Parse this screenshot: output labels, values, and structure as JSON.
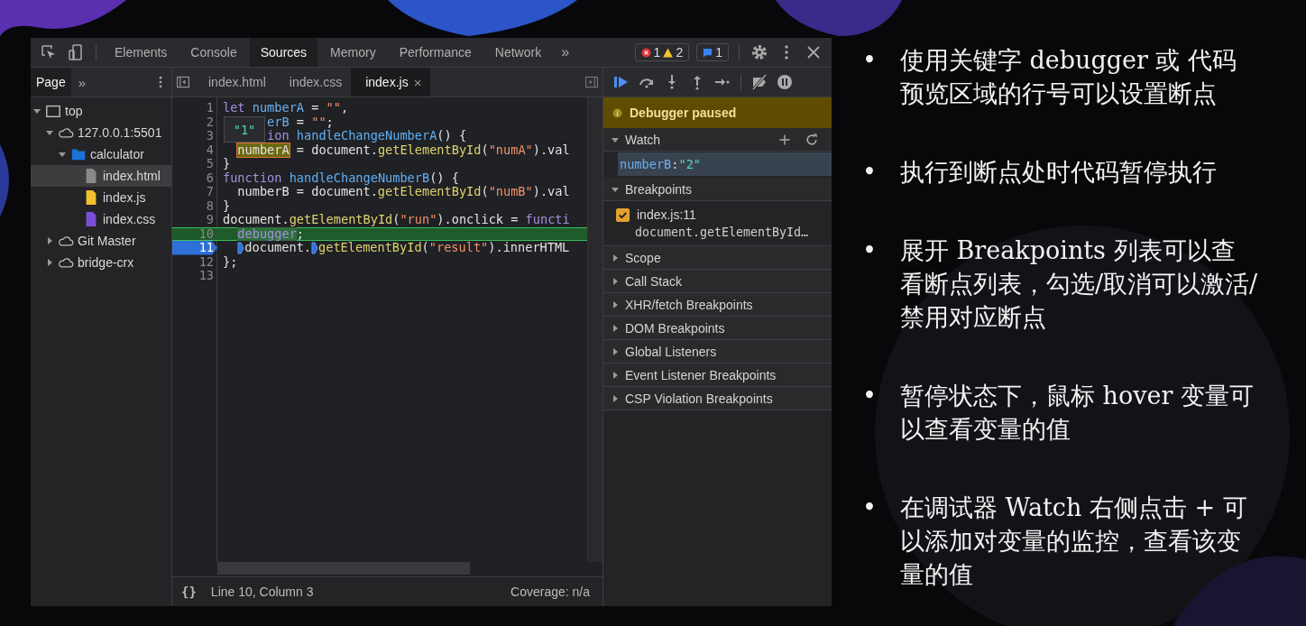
{
  "devtools": {
    "tabs": [
      {
        "label": "Elements",
        "selected": false
      },
      {
        "label": "Console",
        "selected": false
      },
      {
        "label": "Sources",
        "selected": true
      },
      {
        "label": "Memory",
        "selected": false
      },
      {
        "label": "Performance",
        "selected": false
      },
      {
        "label": "Network",
        "selected": false
      }
    ],
    "more_tabs": "»",
    "issues": {
      "errors": "1",
      "warnings": "2",
      "messages": "1"
    },
    "navigator": {
      "tabs": [
        {
          "label": "Page",
          "selected": true
        }
      ],
      "more": "»",
      "tree": [
        {
          "label": "top",
          "kind": "frame",
          "expanded": true,
          "selected": false,
          "children": [
            {
              "label": "127.0.0.1:5501",
              "kind": "cloud",
              "expanded": true,
              "selected": false,
              "children": [
                {
                  "label": "calculator",
                  "kind": "folder",
                  "expanded": true,
                  "selected": false,
                  "children": [
                    {
                      "label": "index.html",
                      "kind": "file",
                      "color": "#8a8a8a",
                      "selected": true
                    },
                    {
                      "label": "index.js",
                      "kind": "file",
                      "color": "#f0c02e",
                      "selected": false
                    },
                    {
                      "label": "index.css",
                      "kind": "file",
                      "color": "#7a4fd8",
                      "selected": false
                    }
                  ]
                }
              ]
            },
            {
              "label": "Git Master",
              "kind": "cloud",
              "expanded": false,
              "selected": false
            },
            {
              "label": "bridge-crx",
              "kind": "cloud",
              "expanded": false,
              "selected": false
            }
          ]
        }
      ]
    },
    "editor": {
      "tabs": [
        {
          "label": "index.html",
          "selected": false,
          "closable": false
        },
        {
          "label": "index.css",
          "selected": false,
          "closable": false
        },
        {
          "label": "index.js",
          "selected": true,
          "closable": true
        }
      ],
      "close_glyph": "×",
      "tooltip": "\"1\"",
      "lines": [
        {
          "number": "1",
          "tokens": [
            {
              "text": "let",
              "kind": "kw"
            },
            {
              "text": " numberA",
              "kind": "var"
            },
            {
              "text": " = ",
              "kind": "plain"
            },
            {
              "text": "\"\"",
              "kind": "str"
            },
            {
              "text": ",",
              "kind": "plain"
            }
          ]
        },
        {
          "number": "2",
          "covered": true,
          "tokens": [
            {
              "text": "erB",
              "kind": "var"
            },
            {
              "text": " = ",
              "kind": "plain"
            },
            {
              "text": "\"\"",
              "kind": "str"
            },
            {
              "text": ";",
              "kind": "plain"
            }
          ]
        },
        {
          "number": "3",
          "covered": true,
          "tokens": [
            {
              "text": "ion",
              "kind": "kw"
            },
            {
              "text": " handleChangeNumberA",
              "kind": "fn"
            },
            {
              "text": "() {",
              "kind": "plain"
            }
          ]
        },
        {
          "number": "4",
          "indent": true,
          "tokens": [
            {
              "text": "numberA",
              "kind": "hover"
            },
            {
              "text": " = document.",
              "kind": "plain"
            },
            {
              "text": "getElementById",
              "kind": "method"
            },
            {
              "text": "(",
              "kind": "plain"
            },
            {
              "text": "\"numA\"",
              "kind": "str"
            },
            {
              "text": ").val",
              "kind": "plain"
            }
          ]
        },
        {
          "number": "5",
          "tokens": [
            {
              "text": "}",
              "kind": "plain"
            }
          ]
        },
        {
          "number": "6",
          "tokens": [
            {
              "text": "function",
              "kind": "kw"
            },
            {
              "text": " handleChangeNumberB",
              "kind": "fn"
            },
            {
              "text": "() {",
              "kind": "plain"
            }
          ]
        },
        {
          "number": "7",
          "indent": true,
          "tokens": [
            {
              "text": "numberB = document.",
              "kind": "plain"
            },
            {
              "text": "getElementById",
              "kind": "method"
            },
            {
              "text": "(",
              "kind": "plain"
            },
            {
              "text": "\"numB\"",
              "kind": "str"
            },
            {
              "text": ").val",
              "kind": "plain"
            }
          ]
        },
        {
          "number": "8",
          "tokens": [
            {
              "text": "}",
              "kind": "plain"
            }
          ]
        },
        {
          "number": "9",
          "tokens": [
            {
              "text": "document.",
              "kind": "plain"
            },
            {
              "text": "getElementById",
              "kind": "method"
            },
            {
              "text": "(",
              "kind": "plain"
            },
            {
              "text": "\"run\"",
              "kind": "str"
            },
            {
              "text": ").onclick = ",
              "kind": "plain"
            },
            {
              "text": "functi",
              "kind": "kw"
            }
          ]
        },
        {
          "number": "10",
          "paused": true,
          "indent": true,
          "tokens": [
            {
              "text": "debugger",
              "kind": "current"
            },
            {
              "text": ";",
              "kind": "plain"
            }
          ]
        },
        {
          "number": "11",
          "breakpoint": true,
          "indent": true,
          "tokens": [
            {
              "kind": "marker"
            },
            {
              "text": "document.",
              "kind": "plain"
            },
            {
              "kind": "marker"
            },
            {
              "text": "getElementById",
              "kind": "method"
            },
            {
              "text": "(",
              "kind": "plain"
            },
            {
              "text": "\"result\"",
              "kind": "str"
            },
            {
              "text": ").innerHTML",
              "kind": "plain"
            }
          ]
        },
        {
          "number": "12",
          "tokens": [
            {
              "text": "};",
              "kind": "plain"
            }
          ]
        },
        {
          "number": "13"
        }
      ],
      "status": {
        "format": "{}",
        "position": "Line 10, Column 3",
        "coverage": "Coverage: n/a"
      }
    },
    "debugger": {
      "banner": "Debugger paused",
      "watch": {
        "title": "Watch",
        "expanded": true,
        "name": "numberB",
        "separator": ":",
        "value": "\"2\""
      },
      "breakpoints": {
        "title": "Breakpoints",
        "expanded": true,
        "items": [
          {
            "location": "index.js:11",
            "code": "document.getElementById…",
            "checked": true
          }
        ]
      },
      "sections": [
        {
          "title": "Scope",
          "expanded": false
        },
        {
          "title": "Call Stack",
          "expanded": false
        },
        {
          "title": "XHR/fetch Breakpoints",
          "expanded": false
        },
        {
          "title": "DOM Breakpoints",
          "expanded": false
        },
        {
          "title": "Global Listeners",
          "expanded": false
        },
        {
          "title": "Event Listener Breakpoints",
          "expanded": false
        },
        {
          "title": "CSP Violation Breakpoints",
          "expanded": false
        }
      ]
    }
  },
  "bullets": [
    "使用关键字 debugger 或 代码预览区域的行号可以设置断点",
    "执行到断点处时代码暂停执行",
    "展开 Breakpoints 列表可以查看断点列表，勾选/取消可以激活/禁用对应断点",
    "暂停状态下，鼠标 hover 变量可以查看变量的值",
    "在调试器 Watch 右侧点击 + 可以添加对变量的监控，查看该变量的值"
  ],
  "bullet_glyph": "•"
}
